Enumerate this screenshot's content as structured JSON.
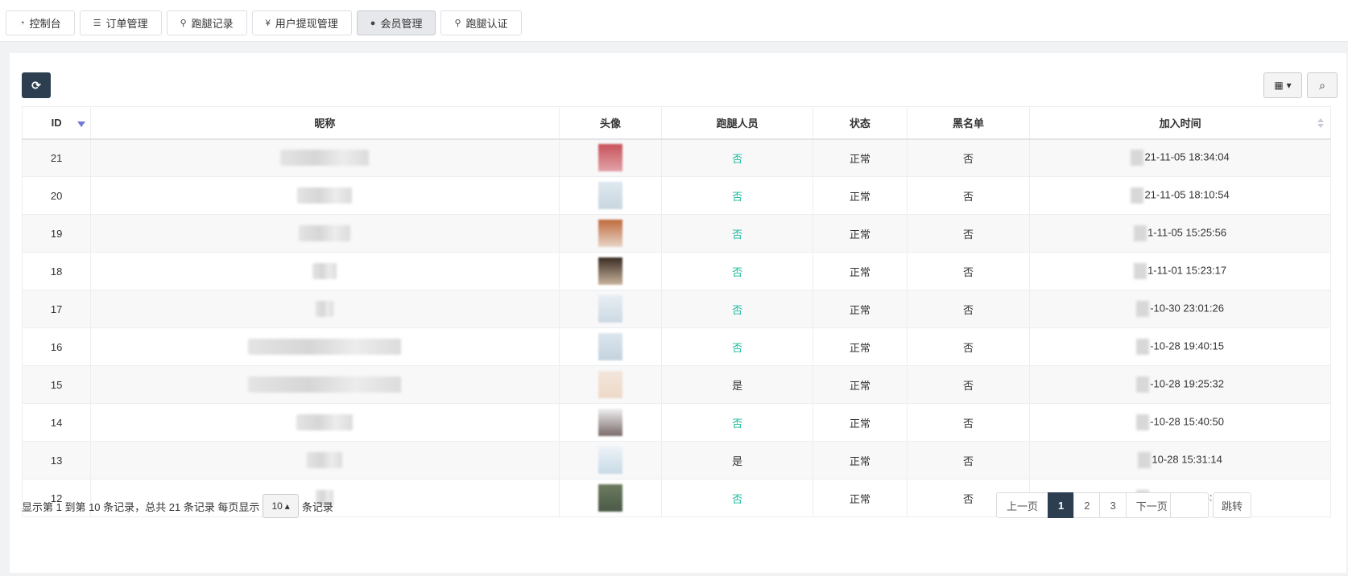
{
  "tabs": [
    {
      "icon": "dashboard-icon",
      "glyph": "◔",
      "label": "控制台",
      "active": false
    },
    {
      "icon": "list-icon",
      "glyph": "☰",
      "label": "订单管理",
      "active": false
    },
    {
      "icon": "bicycle-icon",
      "glyph": "⚲",
      "label": "跑腿记录",
      "active": false
    },
    {
      "icon": "yen-icon",
      "glyph": "¥",
      "label": "用户提现管理",
      "active": false
    },
    {
      "icon": "user-icon",
      "glyph": "●",
      "label": "会员管理",
      "active": true
    },
    {
      "icon": "motorcycle-icon",
      "glyph": "⚲",
      "label": "跑腿认证",
      "active": false
    }
  ],
  "toolbar": {
    "refresh_glyph": "⟳",
    "columns_glyph": "▦",
    "caret_glyph": "▾",
    "search_glyph": "⌕"
  },
  "table": {
    "headers": [
      "ID",
      "昵称",
      "头像",
      "跑腿人员",
      "状态",
      "黑名单",
      "加入时间"
    ],
    "rows": [
      {
        "id": "21",
        "runner": "否",
        "status": "正常",
        "blacklist": "否",
        "joined": "21-11-05 18:34:04"
      },
      {
        "id": "20",
        "runner": "否",
        "status": "正常",
        "blacklist": "否",
        "joined": "21-11-05 18:10:54"
      },
      {
        "id": "19",
        "runner": "否",
        "status": "正常",
        "blacklist": "否",
        "joined": "1-11-05 15:25:56"
      },
      {
        "id": "18",
        "runner": "否",
        "status": "正常",
        "blacklist": "否",
        "joined": "1-11-01 15:23:17"
      },
      {
        "id": "17",
        "runner": "否",
        "status": "正常",
        "blacklist": "否",
        "joined": "-10-30 23:01:26"
      },
      {
        "id": "16",
        "runner": "否",
        "status": "正常",
        "blacklist": "否",
        "joined": "-10-28 19:40:15"
      },
      {
        "id": "15",
        "runner": "是",
        "status": "正常",
        "blacklist": "否",
        "joined": "-10-28 19:25:32"
      },
      {
        "id": "14",
        "runner": "否",
        "status": "正常",
        "blacklist": "否",
        "joined": "-10-28 15:40:50"
      },
      {
        "id": "13",
        "runner": "是",
        "status": "正常",
        "blacklist": "否",
        "joined": "10-28 15:31:14"
      },
      {
        "id": "12",
        "runner": "否",
        "status": "正常",
        "blacklist": "否",
        "joined": "-10-27 10:18:27"
      }
    ]
  },
  "footer": {
    "info_prefix": "显示第 1 到第 10 条记录，总共 21 条记录 每页显示",
    "page_size": "10",
    "page_size_caret": "▴",
    "info_suffix": "条记录"
  },
  "pagination": {
    "prev": "上一页",
    "pages": [
      "1",
      "2",
      "3"
    ],
    "current": "1",
    "next": "下一页",
    "jump": "跳转"
  },
  "colors": {
    "accent": "#2c3e50",
    "green": "#18bc9c",
    "sort_active": "#6f7bd8"
  }
}
